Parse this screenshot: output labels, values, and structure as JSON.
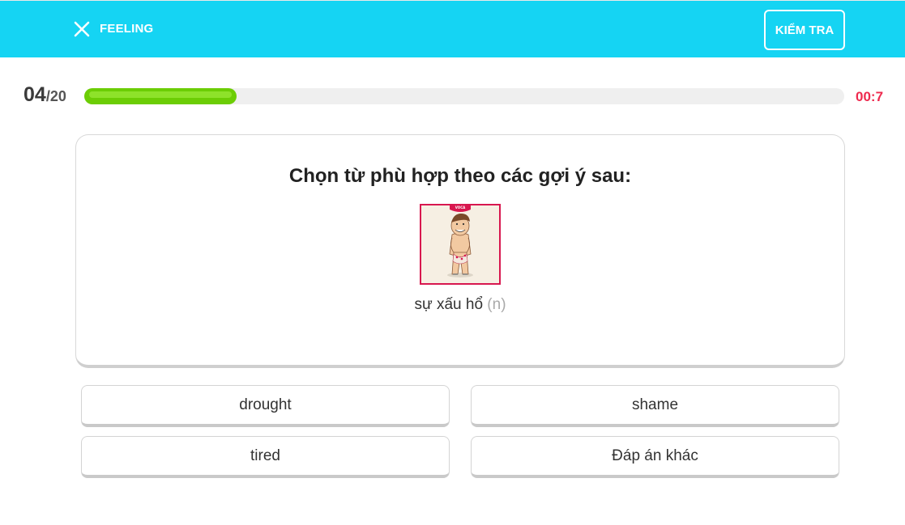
{
  "header": {
    "topic": "FEELING",
    "check_label": "KIỂM TRA",
    "close_icon": "close-icon",
    "background_color": "#15d4f3"
  },
  "progress": {
    "current": "04",
    "total": "/20",
    "fraction": 0.2,
    "timer": "00:7",
    "fill_color": "#6ccd05",
    "timer_color": "#ee2a4e"
  },
  "question": {
    "prompt": "Chọn từ phù hợp theo các gợi ý sau:",
    "image_icon": "embarrassed-man-illustration",
    "image_badge": "VOCA",
    "hint_word": "sự xấu hổ",
    "hint_pos": "(n)"
  },
  "answers": [
    {
      "label": "drought"
    },
    {
      "label": "shame"
    },
    {
      "label": "tired"
    },
    {
      "label": "Đáp án khác"
    }
  ]
}
